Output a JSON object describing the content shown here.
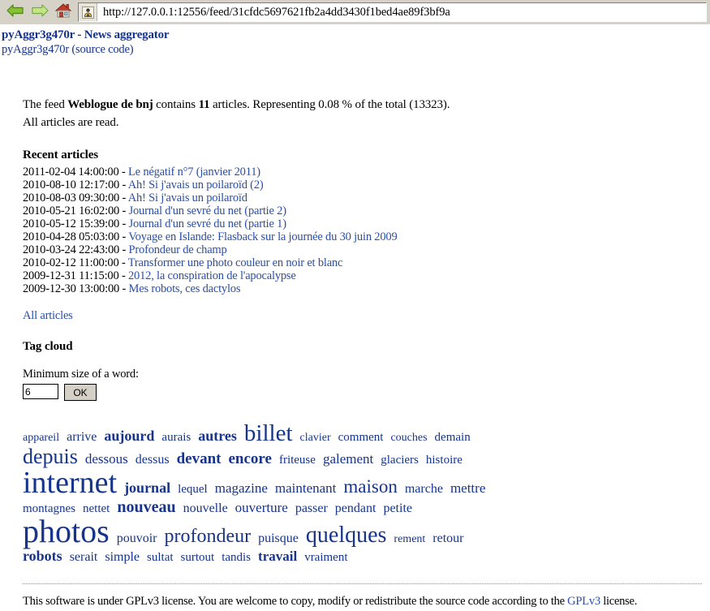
{
  "browser": {
    "back_icon": "back-arrow-icon",
    "forward_icon": "forward-arrow-icon",
    "home_icon": "home-icon",
    "url": "http://127.0.0.1:12556/feed/31cfdc5697621fb2a4dd3430f1bed4ae89f3bf9a",
    "site_icon": "page-favicon"
  },
  "header": {
    "title": "pyAggr3g470r - News aggregator",
    "app_link": "pyAggr3g470r",
    "source_link": "(source code)"
  },
  "summary": {
    "prefix": "The feed ",
    "feed_name": "Weblogue de bnj",
    "middle": " contains ",
    "article_count": "11",
    "suffix": " articles. Representing 0.08 % of the total (13323).",
    "all_read": "All articles are read."
  },
  "recent": {
    "heading": "Recent articles",
    "articles": [
      {
        "date": "2011-02-04 14:00:00",
        "title": "Le négatif n°7 (janvier 2011)"
      },
      {
        "date": "2010-08-10 12:17:00",
        "title": "Ah! Si j'avais un poilaroïd (2)"
      },
      {
        "date": "2010-08-03 09:30:00",
        "title": "Ah! Si j'avais un poilaroïd"
      },
      {
        "date": "2010-05-21 16:02:00",
        "title": "Journal d'un sevré du net (partie 2)"
      },
      {
        "date": "2010-05-12 15:39:00",
        "title": "Journal d'un sevré du net (partie 1)"
      },
      {
        "date": "2010-04-28 05:03:00",
        "title": "Voyage en Islande: Flasback sur la journée du 30 juin 2009"
      },
      {
        "date": "2010-03-24 22:43:00",
        "title": "Profondeur de champ"
      },
      {
        "date": "2010-02-12 11:00:00",
        "title": "Transformer une photo couleur en noir et blanc"
      },
      {
        "date": "2009-12-31 11:15:00",
        "title": "2012, la conspiration de l'apocalypse"
      },
      {
        "date": "2009-12-30 13:00:00",
        "title": "Mes robots, ces dactylos"
      }
    ],
    "all_articles_label": "All articles"
  },
  "tag_cloud": {
    "heading": "Tag cloud",
    "min_size_label": "Minimum size of a word:",
    "min_size_value": "6",
    "submit_label": "OK",
    "link_color": "#16348c",
    "words": [
      {
        "word": "appareil",
        "size": 14
      },
      {
        "word": "arrive",
        "size": 16
      },
      {
        "word": "aujourd",
        "size": 18,
        "bold": true
      },
      {
        "word": "aurais",
        "size": 15
      },
      {
        "word": "autres",
        "size": 18,
        "bold": true
      },
      {
        "word": "billet",
        "size": 29
      },
      {
        "word": "clavier",
        "size": 14
      },
      {
        "word": "comment",
        "size": 15
      },
      {
        "word": "couches",
        "size": 14
      },
      {
        "word": "demain",
        "size": 15
      },
      {
        "word": "depuis",
        "size": 26
      },
      {
        "word": "dessous",
        "size": 17
      },
      {
        "word": "dessus",
        "size": 16
      },
      {
        "word": "devant",
        "size": 19,
        "bold": true
      },
      {
        "word": "encore",
        "size": 19,
        "bold": true
      },
      {
        "word": "friteuse",
        "size": 15
      },
      {
        "word": "galement",
        "size": 17
      },
      {
        "word": "glaciers",
        "size": 15
      },
      {
        "word": "histoire",
        "size": 15
      },
      {
        "word": "internet",
        "size": 38
      },
      {
        "word": "journal",
        "size": 18,
        "bold": true
      },
      {
        "word": "lequel",
        "size": 15
      },
      {
        "word": "magazine",
        "size": 17
      },
      {
        "word": "maintenant",
        "size": 17
      },
      {
        "word": "maison",
        "size": 23
      },
      {
        "word": "marche",
        "size": 16
      },
      {
        "word": "mettre",
        "size": 17
      },
      {
        "word": "montagnes",
        "size": 15
      },
      {
        "word": "nettet",
        "size": 15
      },
      {
        "word": "nouveau",
        "size": 20,
        "bold": true
      },
      {
        "word": "nouvelle",
        "size": 16
      },
      {
        "word": "ouverture",
        "size": 17
      },
      {
        "word": "passer",
        "size": 16
      },
      {
        "word": "pendant",
        "size": 16
      },
      {
        "word": "petite",
        "size": 16
      },
      {
        "word": "photos",
        "size": 40
      },
      {
        "word": "pouvoir",
        "size": 16
      },
      {
        "word": "profondeur",
        "size": 24
      },
      {
        "word": "puisque",
        "size": 16
      },
      {
        "word": "quelques",
        "size": 28
      },
      {
        "word": "rement",
        "size": 14
      },
      {
        "word": "retour",
        "size": 16
      },
      {
        "word": "robots",
        "size": 18,
        "bold": true
      },
      {
        "word": "serait",
        "size": 16
      },
      {
        "word": "simple",
        "size": 16
      },
      {
        "word": "sultat",
        "size": 15
      },
      {
        "word": "surtout",
        "size": 15
      },
      {
        "word": "tandis",
        "size": 15
      },
      {
        "word": "travail",
        "size": 17,
        "bold": true
      },
      {
        "word": "vraiment",
        "size": 15
      }
    ]
  },
  "footer": {
    "text_before": "This software is under GPLv3 license. You are welcome to copy, modify or redistribute the source code according to the ",
    "link": "GPLv3",
    "text_after": " license."
  }
}
